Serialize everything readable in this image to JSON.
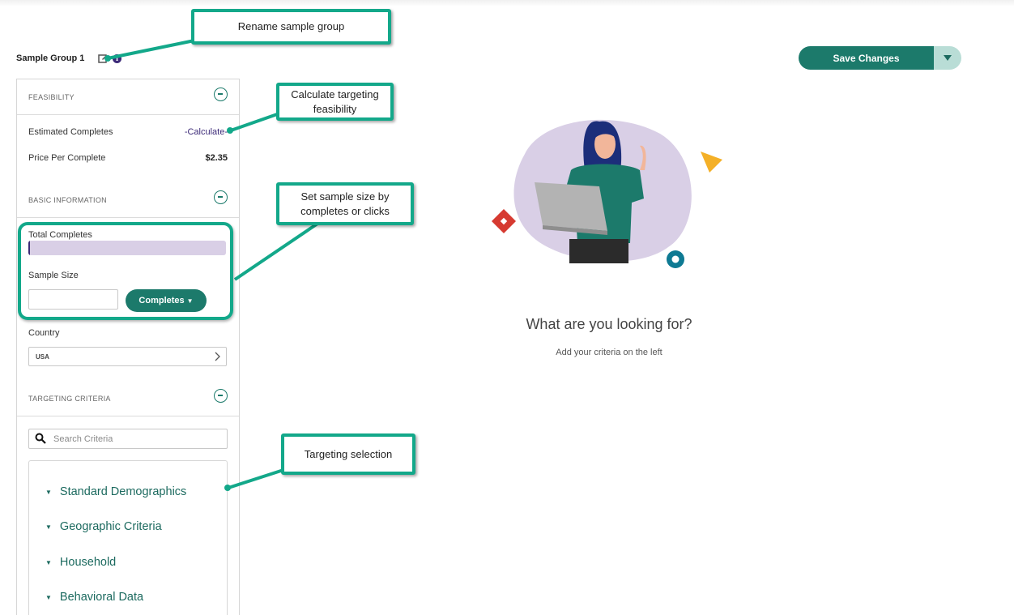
{
  "header": {
    "group_title": "Sample Group 1",
    "info_glyph": "i",
    "save_label": "Save Changes"
  },
  "feasibility": {
    "section_label": "FEASIBILITY",
    "estimated_label": "Estimated Completes",
    "estimated_value": "-Calculate-",
    "price_label": "Price Per Complete",
    "price_value": "$2.35"
  },
  "basic": {
    "section_label": "BASIC INFORMATION",
    "total_label": "Total Completes",
    "total_progress": 0.01,
    "sample_size_label": "Sample Size",
    "sample_size_value": "",
    "completes_button": "Completes",
    "country_label": "Country",
    "country_value": "USA"
  },
  "targeting": {
    "section_label": "TARGETING CRITERIA",
    "search_placeholder": "Search Criteria",
    "categories": [
      "Standard Demographics",
      "Geographic Criteria",
      "Household",
      "Behavioral Data"
    ]
  },
  "empty_state": {
    "title": "What are you looking for?",
    "subtitle": "Add your criteria on the left"
  },
  "callouts": {
    "rename": "Rename sample group",
    "feasibility": "Calculate targeting feasibility",
    "sample_size": "Set sample size by completes or clicks",
    "targeting": "Targeting selection"
  },
  "icons": {
    "edit": "edit-icon",
    "info": "info-icon",
    "collapse": "minus-circle-icon",
    "chevron": "chevron-right-icon",
    "search": "search-icon",
    "dropdown": "caret-down-icon"
  },
  "colors": {
    "brand_teal": "#1c7a6b",
    "callout_border": "#13a88a",
    "accent_purple": "#3c2a78",
    "progress_track": "#d9cfe6"
  }
}
